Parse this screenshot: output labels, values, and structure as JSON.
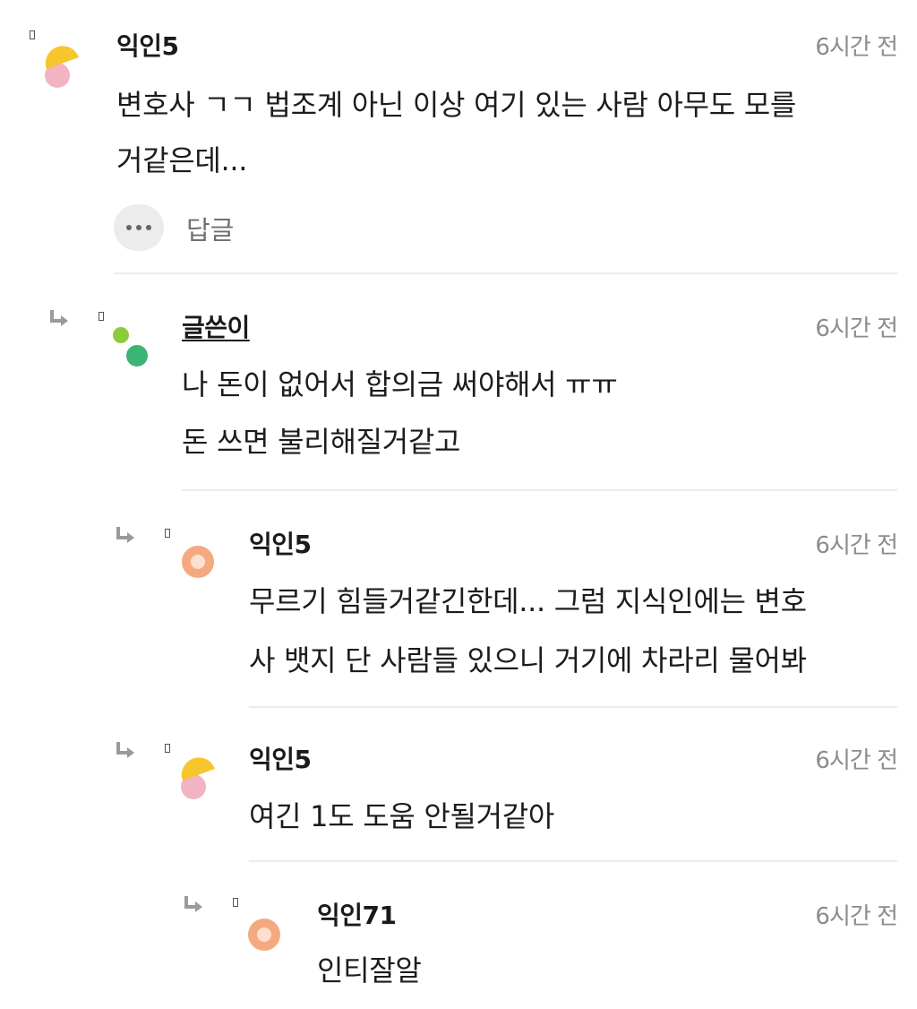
{
  "comments": [
    {
      "author": "익인5",
      "time": "6시간 전",
      "lines": [
        "변호사 ㄱㄱ 법조계 아닌 이상 여기 있는 사람 아무도 모를",
        "거같은데..."
      ],
      "reply_label": "답글",
      "avatar": "yellow-pink-icon"
    },
    {
      "author": "글쓴이",
      "time": "6시간 전",
      "lines": [
        "나 돈이 없어서 합의금 써야해서 ㅠㅠ",
        "돈 쓰면 불리해질거같고"
      ],
      "avatar": "green-dots-icon"
    },
    {
      "author": "익인5",
      "time": "6시간 전",
      "lines": [
        "무르기 힘들거같긴한데... 그럼 지식인에는 변호",
        "사 뱃지 단 사람들 있으니 거기에 차라리 물어봐"
      ],
      "avatar": "orange-ring-icon"
    },
    {
      "author": "익인5",
      "time": "6시간 전",
      "lines": [
        "여긴 1도 도움 안될거같아"
      ],
      "avatar": "yellow-pink-icon"
    },
    {
      "author": "익인71",
      "time": "6시간 전",
      "lines": [
        "인티잘알"
      ],
      "avatar": "orange-ring-icon"
    }
  ],
  "colors": {
    "time_gray": "#8c8c8c",
    "divider": "#ececec",
    "avatar_yellow": "#f7c52c",
    "avatar_pink": "#f3b3c3",
    "avatar_green_light": "#8ccc3c",
    "avatar_green": "#3cb474",
    "avatar_orange": "#f5a981"
  }
}
